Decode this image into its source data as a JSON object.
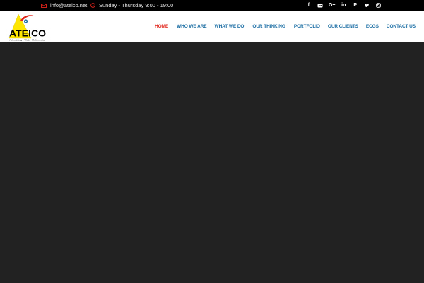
{
  "topbar": {
    "email": "info@ateico.net",
    "hours": "Sunday - Thursday 9:00 - 19:00",
    "social": [
      {
        "name": "facebook-icon",
        "glyph": "f"
      },
      {
        "name": "flickr-icon",
        "glyph": "●●"
      },
      {
        "name": "google-plus-icon",
        "glyph": "G+"
      },
      {
        "name": "linkedin-icon",
        "glyph": "in"
      },
      {
        "name": "pinterest-icon",
        "glyph": "P"
      },
      {
        "name": "twitter-icon",
        "glyph": "✈"
      },
      {
        "name": "instagram-icon",
        "glyph": "◎"
      }
    ]
  },
  "logo": {
    "name": "ATEICO",
    "tagline": "Advertising · Web · Multimedia"
  },
  "nav": {
    "home": "HOME",
    "who_we_are": "WHO WE ARE",
    "what_we_do": "WHAT WE DO",
    "our_thinking": "OUR THINKING",
    "portfolio": "PORTFOLIO",
    "our_clients": "OUR CLIENTS",
    "ecgs": "ECGS",
    "contact_us": "CONTACT US"
  },
  "colors": {
    "topbar_bg": "#000000",
    "header_bg": "#ffffff",
    "nav_text": "#1c6ea4",
    "nav_active": "#e1251b",
    "icon_red": "#e1251b",
    "hero_bg": "#222222",
    "logo_yellow": "#ffe600"
  }
}
